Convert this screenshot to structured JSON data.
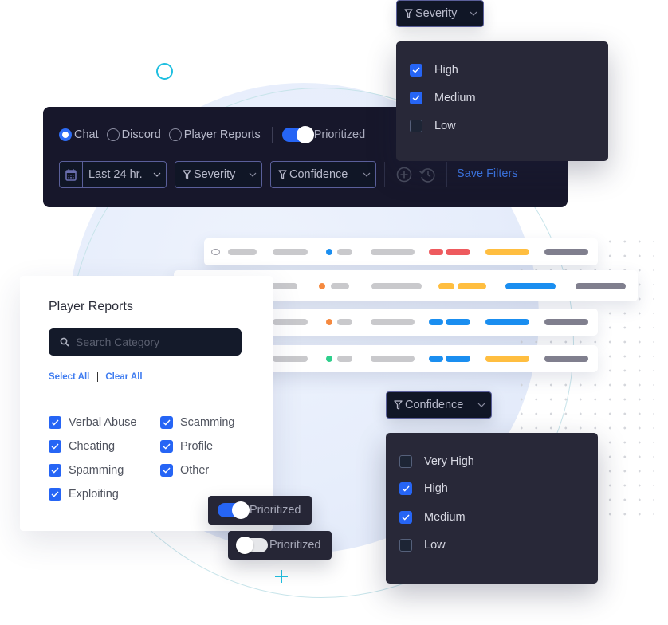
{
  "filter_bar": {
    "sources": [
      {
        "label": "Chat",
        "selected": true
      },
      {
        "label": "Discord",
        "selected": false
      },
      {
        "label": "Player Reports",
        "selected": false
      }
    ],
    "prioritized": {
      "label": "Prioritized",
      "on": true
    },
    "date_range": {
      "value": "Last 24 hr.",
      "icon": "calendar-icon"
    },
    "severity": {
      "label": "Severity",
      "icon": "filter-icon"
    },
    "confidence": {
      "label": "Confidence",
      "icon": "filter-icon"
    },
    "add_icon": "add-circle-icon",
    "history_icon": "history-icon",
    "save_filters": "Save Filters"
  },
  "severity_dropdown": {
    "label": "Severity",
    "options": [
      {
        "label": "High",
        "checked": true
      },
      {
        "label": "Medium",
        "checked": true
      },
      {
        "label": "Low",
        "checked": false
      }
    ]
  },
  "confidence_dropdown": {
    "label": "Confidence",
    "options": [
      {
        "label": "Very High",
        "checked": false
      },
      {
        "label": "High",
        "checked": true
      },
      {
        "label": "Medium",
        "checked": true
      },
      {
        "label": "Low",
        "checked": false
      }
    ]
  },
  "table_rows": [
    {
      "status_dot": "#1a8ef0",
      "tag_color": "#ee5a5e",
      "bar_color": "#ffbe40"
    },
    {
      "status_dot": "#f5893f",
      "tag_color": "#ffbe40",
      "bar_color": "#1a8ef0"
    },
    {
      "status_dot": "#f5893f",
      "tag_color": "#1a8ef0",
      "bar_color": "#1a8ef0"
    },
    {
      "status_dot": "#2ecf8c",
      "tag_color": "#1a8ef0",
      "bar_color": "#ffbe40"
    }
  ],
  "player_reports": {
    "title": "Player Reports",
    "search_placeholder": "Search Category",
    "select_all": "Select All",
    "clear_all": "Clear All",
    "categories": [
      {
        "label": "Verbal Abuse",
        "checked": true
      },
      {
        "label": "Scamming",
        "checked": true
      },
      {
        "label": "Cheating",
        "checked": true
      },
      {
        "label": "Profile",
        "checked": true
      },
      {
        "label": "Spamming",
        "checked": true
      },
      {
        "label": "Other",
        "checked": true
      },
      {
        "label": "Exploiting",
        "checked": true
      }
    ]
  },
  "floating_toggles": [
    {
      "label": "Prioritized",
      "on": true
    },
    {
      "label": "Prioritized",
      "on": false
    }
  ],
  "colors": {
    "accent": "#2665f5",
    "link": "#3f7cf0",
    "panel_dark": "#17172b",
    "dropdown_bg": "#282838",
    "decor_cyan": "#1fbfe0"
  }
}
